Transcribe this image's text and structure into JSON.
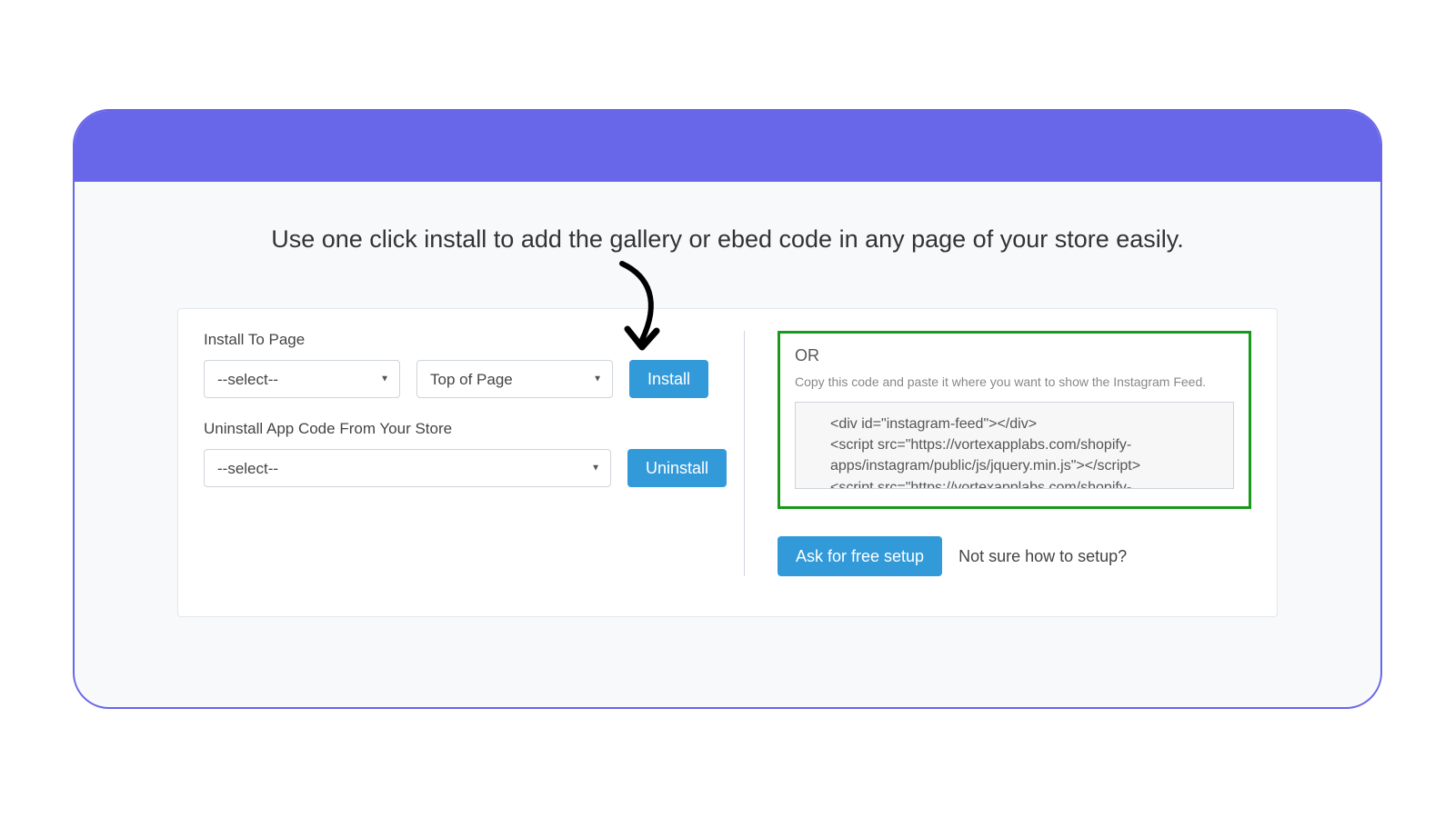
{
  "headline": "Use one click install to add the gallery or ebed code in any page of your store easily.",
  "install": {
    "label": "Install To Page",
    "page_select": "--select--",
    "position_select": "Top of Page",
    "button": "Install"
  },
  "uninstall": {
    "label": "Uninstall App Code From Your Store",
    "page_select": "--select--",
    "button": "Uninstall"
  },
  "embed": {
    "or": "OR",
    "hint": "Copy this code and paste it where you want to show the Instagram Feed.",
    "code": "<div id=\"instagram-feed\"></div>\n<script src=\"https://vortexapplabs.com/shopify-apps/instagram/public/js/jquery.min.js\"></script>\n<script src=\"https://vortexapplabs.com/shopify-"
  },
  "help": {
    "button": "Ask for free setup",
    "text": "Not sure how to setup?"
  }
}
